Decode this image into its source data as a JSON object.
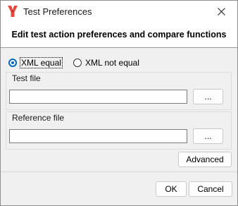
{
  "window": {
    "title": "Test Preferences",
    "header": "Edit test action preferences and compare functions"
  },
  "compare": {
    "options": [
      {
        "label": "XML equal",
        "selected": true
      },
      {
        "label": "XML not equal",
        "selected": false
      }
    ]
  },
  "test_file": {
    "label": "Test file",
    "value": "",
    "browse_label": "..."
  },
  "reference_file": {
    "label": "Reference file",
    "value": "",
    "browse_label": "..."
  },
  "buttons": {
    "advanced": "Advanced",
    "ok": "OK",
    "cancel": "Cancel"
  },
  "colors": {
    "accent": "#0067c0",
    "logo": "#e8473d"
  }
}
